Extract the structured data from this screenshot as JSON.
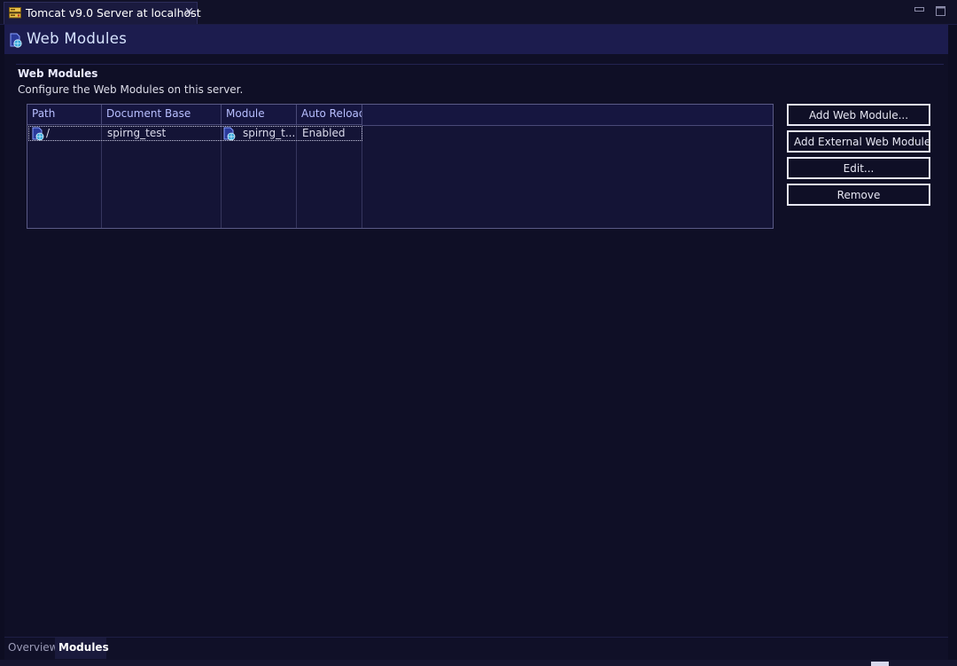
{
  "editor_tab": {
    "title": "Tomcat v9.0 Server at localhost",
    "close": "×"
  },
  "page_header": {
    "title": "Web Modules"
  },
  "section": {
    "title": "Web Modules",
    "description": "Configure the Web Modules on this server."
  },
  "table": {
    "columns": [
      "Path",
      "Document Base",
      "Module",
      "Auto Reload"
    ],
    "rows": [
      {
        "path": "/",
        "document_base": "spirng_test",
        "module": "spirng_t...",
        "auto_reload": "Enabled"
      }
    ]
  },
  "buttons": {
    "add_web_module": "Add Web Module...",
    "add_external_web_module": "Add External Web Module...",
    "edit": "Edit...",
    "remove": "Remove"
  },
  "bottom_tabs": [
    {
      "label": "Overview",
      "active": false
    },
    {
      "label": "Modules",
      "active": true
    }
  ],
  "icons": {
    "tab": "server-icon",
    "header": "web-module-icon",
    "row_path": "web-module-icon",
    "row_module": "web-module-icon"
  },
  "colors": {
    "background": "#0d0d22",
    "header_bg": "#1c1c4e",
    "column_header_text": "#b8bfff",
    "button_border": "#e6e6f2"
  }
}
